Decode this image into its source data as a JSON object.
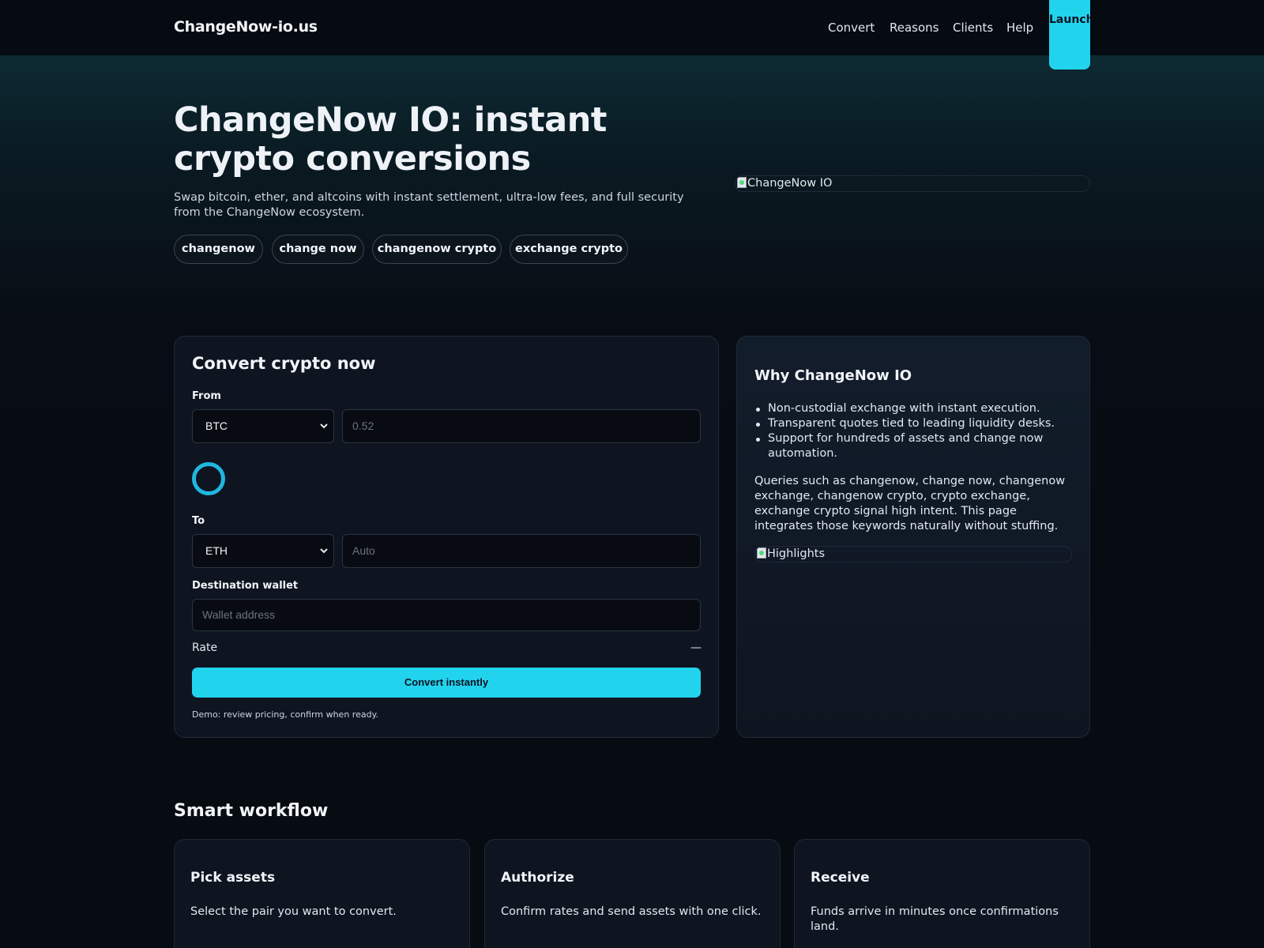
{
  "header": {
    "brand": "ChangeNow-io.us",
    "nav": [
      "Convert",
      "Reasons",
      "Clients",
      "Help"
    ],
    "launch_label": "Launch"
  },
  "hero": {
    "title": "ChangeNow IO: instant crypto conversions",
    "subtitle": "Swap bitcoin, ether, and altcoins with instant settlement, ultra-low fees, and full security from the ChangeNow ecosystem.",
    "chips": [
      "changenow",
      "change now",
      "changenow crypto",
      "exchange crypto"
    ],
    "image_alt": "ChangeNow IO"
  },
  "converter": {
    "title": "Convert crypto now",
    "from_label": "From",
    "from_asset": "BTC",
    "from_amount_placeholder": "0.52",
    "to_label": "To",
    "to_asset": "ETH",
    "to_amount_placeholder": "Auto",
    "wallet_label": "Destination wallet",
    "wallet_placeholder": "Wallet address",
    "rate_label": "Rate",
    "rate_value": "—",
    "convert_label": "Convert instantly",
    "note": "Demo: review pricing, confirm when ready."
  },
  "why": {
    "title": "Why ChangeNow IO",
    "bullets": [
      "Non-custodial exchange with instant execution.",
      "Transparent quotes tied to leading liquidity desks.",
      "Support for hundreds of assets and change now automation."
    ],
    "paragraph": "Queries such as changenow, change now, changenow exchange, changenow crypto, crypto exchange, exchange crypto signal high intent. This page integrates those keywords naturally without stuffing.",
    "image_alt": "Highlights"
  },
  "workflow": {
    "title": "Smart workflow",
    "steps": [
      {
        "title": "Pick assets",
        "desc": "Select the pair you want to convert."
      },
      {
        "title": "Authorize",
        "desc": "Confirm rates and send assets with one click."
      },
      {
        "title": "Receive",
        "desc": "Funds arrive in minutes once confirmations land."
      }
    ]
  },
  "colors": {
    "accent": "#22d3ee",
    "background": "#070b12",
    "card": "#0e1520"
  }
}
